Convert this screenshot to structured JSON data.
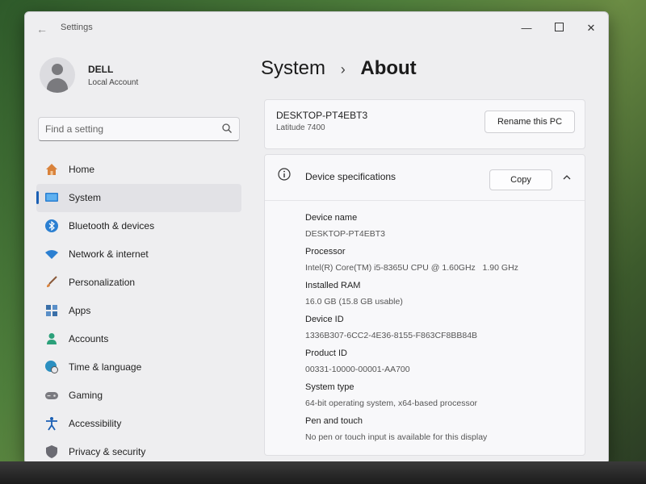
{
  "window": {
    "title": "Settings"
  },
  "profile": {
    "name": "DELL",
    "account_type": "Local Account"
  },
  "search": {
    "placeholder": "Find a setting"
  },
  "nav": {
    "items": [
      {
        "label": "Home",
        "icon": "home-icon"
      },
      {
        "label": "System",
        "icon": "monitor-icon",
        "selected": true
      },
      {
        "label": "Bluetooth & devices",
        "icon": "bluetooth-icon"
      },
      {
        "label": "Network & internet",
        "icon": "wifi-icon"
      },
      {
        "label": "Personalization",
        "icon": "brush-icon"
      },
      {
        "label": "Apps",
        "icon": "apps-icon"
      },
      {
        "label": "Accounts",
        "icon": "person-icon"
      },
      {
        "label": "Time & language",
        "icon": "globe-clock-icon"
      },
      {
        "label": "Gaming",
        "icon": "gamepad-icon"
      },
      {
        "label": "Accessibility",
        "icon": "accessibility-icon"
      },
      {
        "label": "Privacy & security",
        "icon": "shield-icon"
      }
    ]
  },
  "breadcrumb": {
    "parent": "System",
    "separator": "›",
    "current": "About"
  },
  "pc_card": {
    "device_name": "DESKTOP-PT4EBT3",
    "model": "Latitude 7400",
    "rename_label": "Rename this PC"
  },
  "specs": {
    "title": "Device specifications",
    "copy_label": "Copy",
    "rows": [
      {
        "label": "Device name",
        "value": "DESKTOP-PT4EBT3"
      },
      {
        "label": "Processor",
        "value": "Intel(R) Core(TM) i5-8365U CPU @ 1.60GHz   1.90 GHz"
      },
      {
        "label": "Installed RAM",
        "value": "16.0 GB (15.8 GB usable)"
      },
      {
        "label": "Device ID",
        "value": "1336B307-6CC2-4E36-8155-F863CF8BB84B"
      },
      {
        "label": "Product ID",
        "value": "00331-10000-00001-AA700"
      },
      {
        "label": "System type",
        "value": "64-bit operating system, x64-based processor"
      },
      {
        "label": "Pen and touch",
        "value": "No pen or touch input is available for this display"
      }
    ]
  },
  "colors": {
    "accent": "#1a5fb4",
    "window_bg": "#eeeef0",
    "card_bg": "#f8f8fa"
  }
}
